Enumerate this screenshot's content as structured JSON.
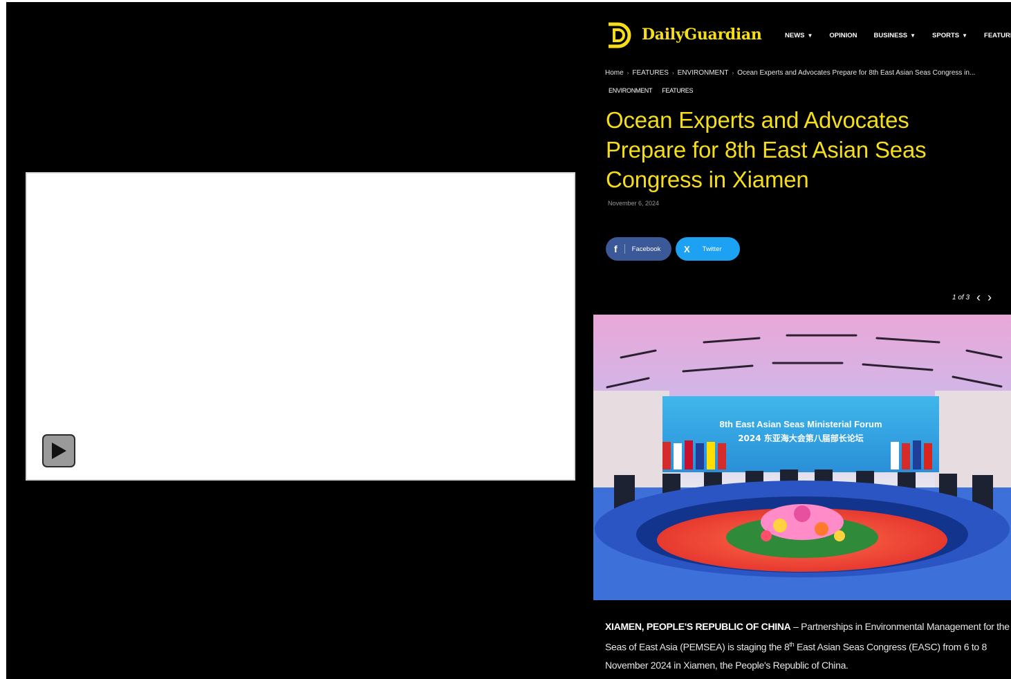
{
  "site": {
    "brand": "DailyGuardian",
    "nav": [
      {
        "label": "NEWS",
        "dropdown": true
      },
      {
        "label": "OPINION",
        "dropdown": false
      },
      {
        "label": "BUSINESS",
        "dropdown": true
      },
      {
        "label": "SPORTS",
        "dropdown": true
      },
      {
        "label": "FEATURES",
        "dropdown": false
      }
    ],
    "accent_color": "#f5dd1a"
  },
  "breadcrumb": [
    "Home",
    "FEATURES",
    "ENVIRONMENT",
    "Ocean Experts and Advocates Prepare for 8th East Asian Seas Congress in..."
  ],
  "tags": [
    "ENVIRONMENT",
    "FEATURES"
  ],
  "article": {
    "title": "Ocean Experts and Advocates Prepare for 8th East Asian Seas Congress in Xiamen",
    "date": "November 6, 2024",
    "lead_dateline": "XIAMEN, PEOPLE'S REPUBLIC OF CHINA",
    "lead_part1": " – Partnerships in Environmental Management for the Seas of East Asia (PEMSEA) is staging the 8",
    "lead_sup": "th",
    "lead_part2": " East Asian Seas Congress (EASC) from 6 to 8 November 2024 in Xiamen, the People's Republic of China."
  },
  "share": {
    "facebook": "Facebook",
    "twitter": "Twitter"
  },
  "gallery": {
    "count": "1 of 3"
  },
  "photo": {
    "banner_line1": "8th East Asian Seas Ministerial Forum",
    "banner_line2": "2024 东亚海大会第八届部长论坛"
  },
  "icons": {
    "play": "play-icon",
    "facebook": "facebook-icon",
    "twitter": "x-icon",
    "prev": "chevron-left-icon",
    "next": "chevron-right-icon"
  }
}
